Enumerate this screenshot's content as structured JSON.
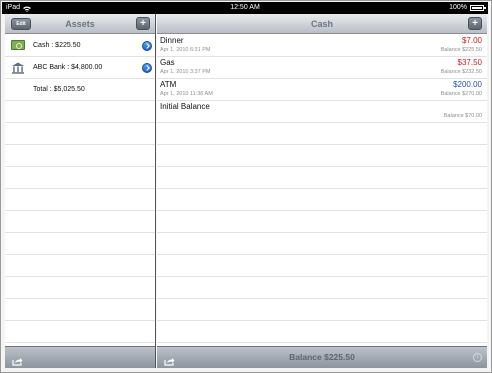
{
  "status_bar": {
    "device": "iPad",
    "time": "12:50 AM",
    "battery_text": "100%",
    "battery_level": 1.0
  },
  "assets_pane": {
    "title": "Assets",
    "edit_label": "Edit",
    "add_label": "+",
    "items": [
      {
        "label": "Cash : $225.50",
        "icon": "cash-icon"
      },
      {
        "label": "ABC Bank : $4,800.00",
        "icon": "bank-icon"
      }
    ],
    "total_label": "Total : $5,025.50"
  },
  "cash_pane": {
    "title": "Cash",
    "add_label": "+",
    "transactions": [
      {
        "name": "Dinner",
        "amount": "$7.00",
        "date": "Apr 1, 2010 6:31 PM",
        "balance": "Balance $225.50",
        "amount_color": "#cc1f1f"
      },
      {
        "name": "Gas",
        "amount": "$37.50",
        "date": "Apr 1, 2010 3:37 PM",
        "balance": "Balance $232.50",
        "amount_color": "#cc1f1f"
      },
      {
        "name": "ATM",
        "amount": "$200.00",
        "date": "Apr 1, 2010 11:36 AM",
        "balance": "Balance $270.00",
        "amount_color": "#2a4fa8"
      },
      {
        "name": "Initial Balance",
        "amount": "",
        "date": "",
        "balance": "Balance $70.00",
        "amount_color": "#2a4fa8"
      }
    ],
    "footer_balance": "Balance $225.50"
  },
  "colors": {
    "debit": "#cc1f1f",
    "credit": "#2a4fa8",
    "navbar_title": "#6d7480"
  }
}
